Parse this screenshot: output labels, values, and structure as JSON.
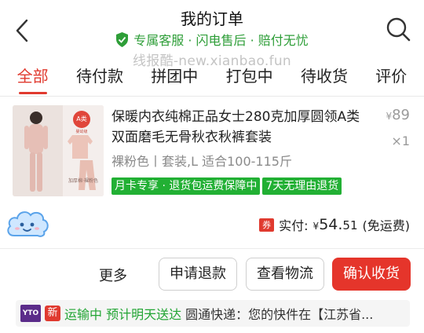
{
  "header": {
    "title": "我的订单",
    "guarantee": "专属客服 · 闪电售后 · 赔付无忧"
  },
  "watermark": "线报酷-new.xianbao.fun",
  "tabs": [
    {
      "label": "全部",
      "active": true
    },
    {
      "label": "待付款",
      "active": false
    },
    {
      "label": "拼团中",
      "active": false
    },
    {
      "label": "打包中",
      "active": false
    },
    {
      "label": "待收货",
      "active": false
    },
    {
      "label": "评价",
      "active": false
    }
  ],
  "order": {
    "product_name": "保暖内衣纯棉正品女士280克加厚圆领A类双面磨毛无骨秋衣秋裤套装",
    "price_symbol": "¥",
    "price": "89",
    "quantity": "×1",
    "spec": "裸粉色丨套装,L 适合100-115斤",
    "badges": [
      "月卡专享 · 退货包运费保障中",
      "7天无理由退货"
    ],
    "thumb_badge": "A类",
    "thumb_badge_sub": "婴幼级",
    "thumb_caption": "加厚棉·裸粉色",
    "paid_label": "实付:",
    "paid_symbol": "¥",
    "paid_int": "54.",
    "paid_dec": "51",
    "shipping_fee": "(免运费)",
    "coupon_icon": "券"
  },
  "actions": {
    "more": "更多",
    "refund": "申请退款",
    "logistics": "查看物流",
    "confirm": "确认收货"
  },
  "shipping": {
    "courier_logo": "YTO",
    "new_label": "新",
    "status": "运输中 预计明天送达",
    "detail": "圆通快递：您的快件在【江苏省..."
  },
  "colors": {
    "accent_red": "#e03a2f",
    "green": "#22b034",
    "yto_purple": "#5b2c8a"
  }
}
